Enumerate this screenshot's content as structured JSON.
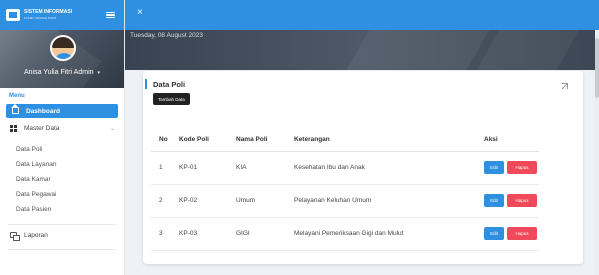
{
  "brand": {
    "title": "SISTEM INFORMASI",
    "subtitle": "KLINIK / RUMAH SAKIT"
  },
  "topbar": {
    "close_icon": "×"
  },
  "profile": {
    "name": "Anisa Yulia Fitri Admin",
    "caret": "▾"
  },
  "menu": {
    "label": "Menu",
    "dashboard": "Dashboard",
    "master": "Master Data",
    "master_chevron": "⌄",
    "sub_items": [
      "Data Poli",
      "Data Layanan",
      "Data Kamar",
      "Data Pegawai",
      "Data Pasien"
    ],
    "report": "Laporan"
  },
  "hero": {
    "date": "Tuesday, 08 August 2023"
  },
  "card": {
    "title": "Data Poli",
    "add_button": "Tambah Data",
    "columns": [
      "No",
      "Kode Poli",
      "Nama Poli",
      "Keterangan",
      "Aksi"
    ],
    "rows": [
      {
        "no": "1",
        "kode": "KP-01",
        "nama": "KIA",
        "ket": "Kesehatan Ibu dan Anak"
      },
      {
        "no": "2",
        "kode": "KP-02",
        "nama": "Umum",
        "ket": "Pelayanan Keluhan Umum"
      },
      {
        "no": "3",
        "kode": "KP-03",
        "nama": "GIGI",
        "ket": "Melayani Pemeriksaan Gigi dan Mulut"
      }
    ],
    "edit_label": "Edit",
    "delete_label": "Hapus"
  },
  "colors": {
    "accent": "#2f8fe0",
    "danger": "#f04a5a",
    "dark": "#222222"
  }
}
